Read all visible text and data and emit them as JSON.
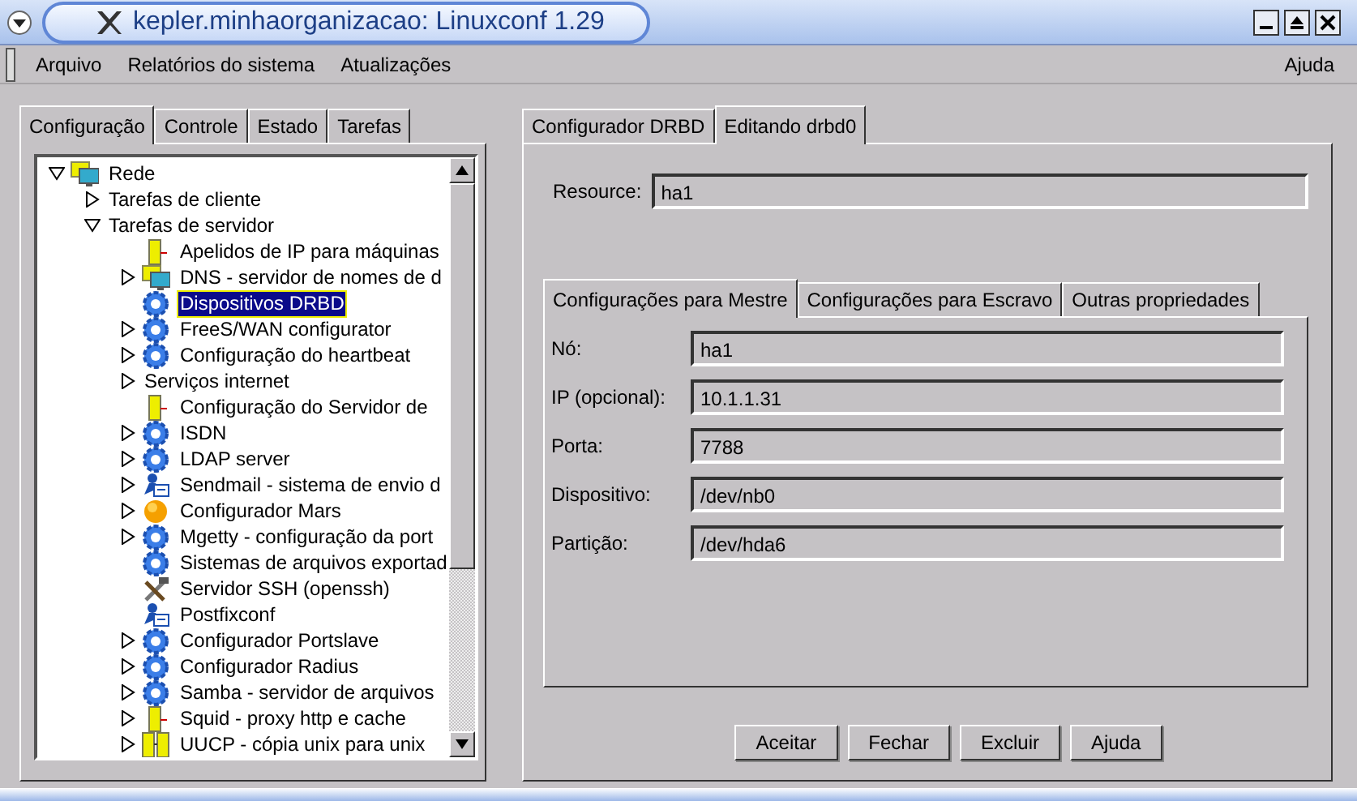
{
  "window": {
    "title": "kepler.minhaorganizacao: Linuxconf 1.29"
  },
  "menu": [
    {
      "label": "Arquivo"
    },
    {
      "label": "Relatórios do sistema"
    },
    {
      "label": "Atualizações"
    }
  ],
  "help_menu": "Ajuda",
  "left_tabs": [
    {
      "label": "Configuração",
      "selected": true
    },
    {
      "label": "Controle",
      "selected": false
    },
    {
      "label": "Estado",
      "selected": false
    },
    {
      "label": "Tarefas",
      "selected": false
    }
  ],
  "tree": [
    {
      "label": "Rede",
      "kind": "network",
      "expanded": true,
      "selected": false,
      "children": [
        {
          "label": "Tarefas de cliente",
          "expanded": false,
          "selected": false
        },
        {
          "label": "Tarefas de servidor",
          "expanded": true,
          "selected": false,
          "children": [
            {
              "label": "Apelidos de IP para máquinas",
              "kind": "server",
              "selected": false
            },
            {
              "label": "DNS - servidor de nomes de d",
              "kind": "network",
              "expanded": false,
              "selected": false
            },
            {
              "label": "Dispositivos DRBD",
              "kind": "gear",
              "selected": true
            },
            {
              "label": "FreeS/WAN configurator",
              "kind": "gear",
              "expanded": false,
              "selected": false
            },
            {
              "label": "Configuração do heartbeat",
              "kind": "gear",
              "expanded": false,
              "selected": false
            },
            {
              "label": "Serviços internet",
              "expanded": false,
              "selected": false
            },
            {
              "label": "Configuração do Servidor de",
              "kind": "server",
              "selected": false
            },
            {
              "label": "ISDN",
              "kind": "gear",
              "expanded": false,
              "selected": false
            },
            {
              "label": "LDAP server",
              "kind": "gear",
              "expanded": false,
              "selected": false
            },
            {
              "label": "Sendmail - sistema de envio d",
              "kind": "mail",
              "expanded": false,
              "selected": false
            },
            {
              "label": "Configurador Mars",
              "kind": "sun",
              "expanded": false,
              "selected": false
            },
            {
              "label": "Mgetty - configuração da port",
              "kind": "gear",
              "expanded": false,
              "selected": false
            },
            {
              "label": "Sistemas de arquivos exportad",
              "kind": "gear",
              "selected": false
            },
            {
              "label": "Servidor SSH (openssh)",
              "kind": "tools",
              "selected": false
            },
            {
              "label": "Postfixconf",
              "kind": "mail",
              "selected": false
            },
            {
              "label": "Configurador Portslave",
              "kind": "gear",
              "expanded": false,
              "selected": false
            },
            {
              "label": "Configurador Radius",
              "kind": "gear",
              "expanded": false,
              "selected": false
            },
            {
              "label": "Samba - servidor de arquivos",
              "kind": "gear",
              "expanded": false,
              "selected": false
            },
            {
              "label": "Squid - proxy http e cache",
              "kind": "server",
              "expanded": false,
              "selected": false
            },
            {
              "label": "UUCP - cópia unix para unix",
              "kind": "servers",
              "expanded": false,
              "selected": false
            }
          ]
        }
      ]
    }
  ],
  "right_tabs": [
    {
      "label": "Configurador DRBD",
      "selected": false
    },
    {
      "label": "Editando drbd0",
      "selected": true
    }
  ],
  "resource": {
    "label": "Resource:",
    "value": "ha1"
  },
  "inner_tabs": [
    {
      "label": "Configurações para Mestre",
      "selected": true
    },
    {
      "label": "Configurações para Escravo",
      "selected": false
    },
    {
      "label": "Outras propriedades",
      "selected": false
    }
  ],
  "fields": [
    {
      "label": "Nó:",
      "value": "ha1"
    },
    {
      "label": "IP (opcional):",
      "value": "10.1.1.31"
    },
    {
      "label": "Porta:",
      "value": "7788"
    },
    {
      "label": "Dispositivo:",
      "value": "/dev/nb0"
    },
    {
      "label": "Partição:",
      "value": "/dev/hda6"
    }
  ],
  "buttons": [
    "Aceitar",
    "Fechar",
    "Excluir",
    "Ajuda"
  ]
}
